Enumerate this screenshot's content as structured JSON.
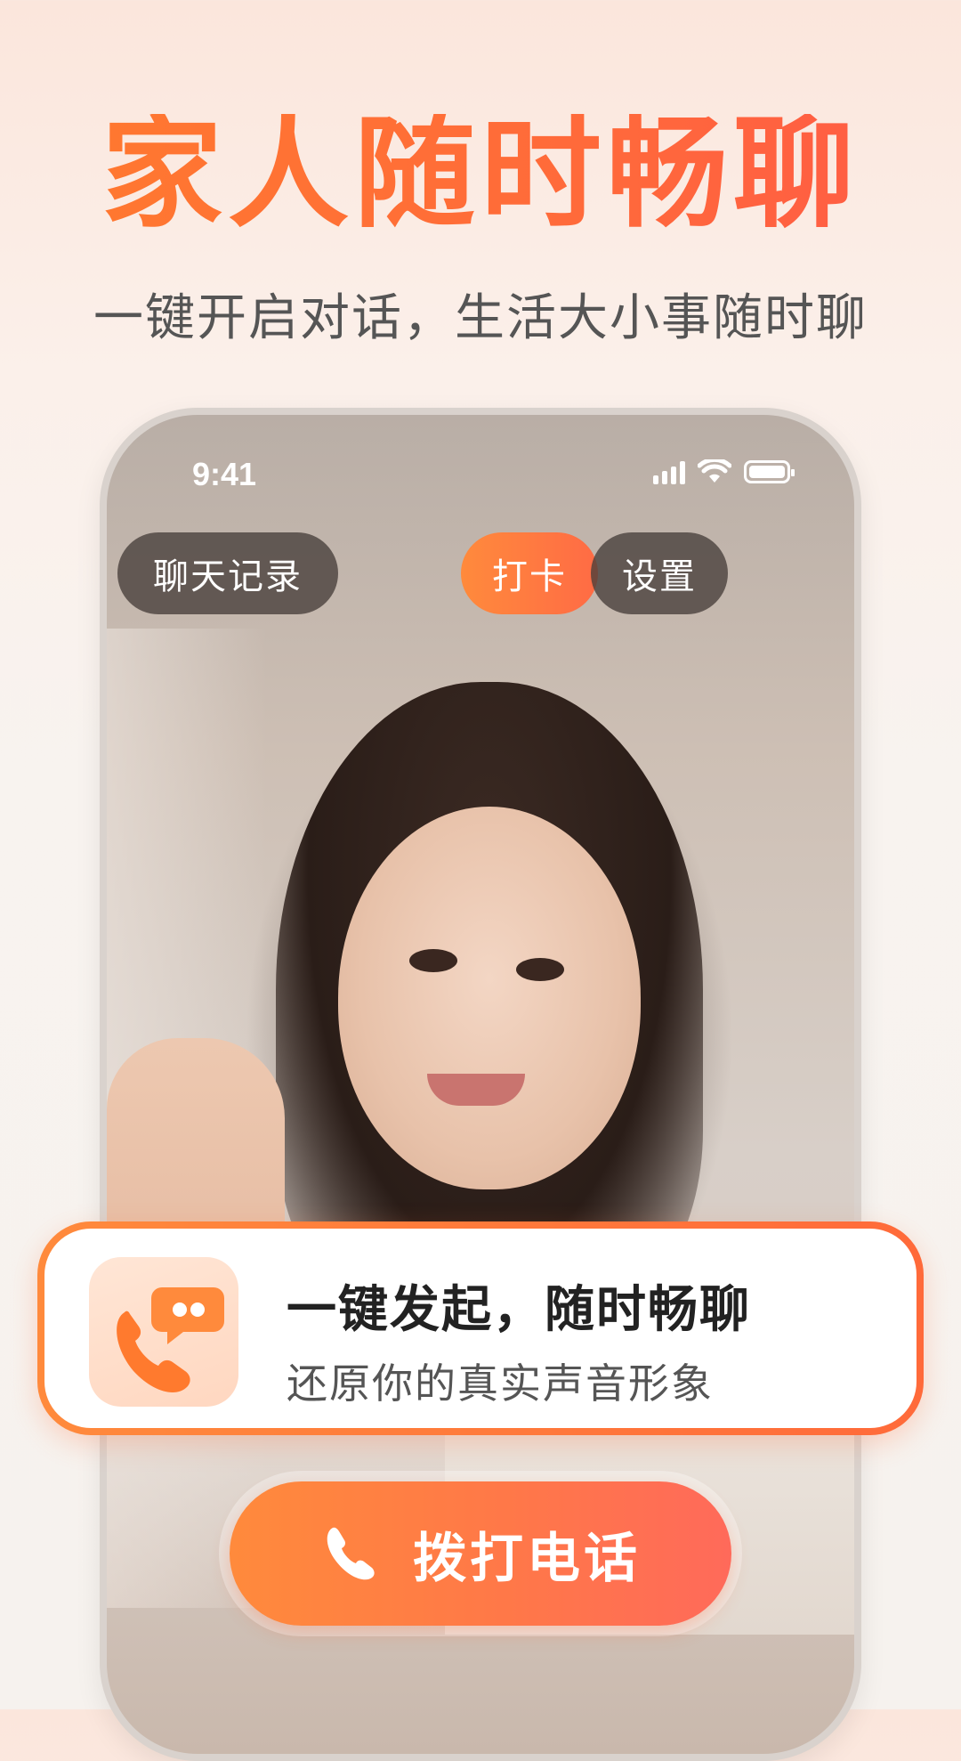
{
  "promo": {
    "headline": "家人随时畅聊",
    "subheadline": "一键开启对话，生活大小事随时聊"
  },
  "phone": {
    "status_bar": {
      "time": "9:41"
    },
    "top_actions": {
      "history_label": "聊天记录",
      "checkin_label": "打卡",
      "settings_label": "设置"
    }
  },
  "feature_card": {
    "title": "一键发起，随时畅聊",
    "subtitle": "还原你的真实声音形象",
    "icon": "phone-chat-app-icon"
  },
  "call_button": {
    "label": "拨打电话",
    "icon": "phone-handset-icon"
  },
  "colors": {
    "accent_orange": "#ff7a2e",
    "accent_red": "#ff6a5a",
    "pill_dark": "#463e3a"
  }
}
